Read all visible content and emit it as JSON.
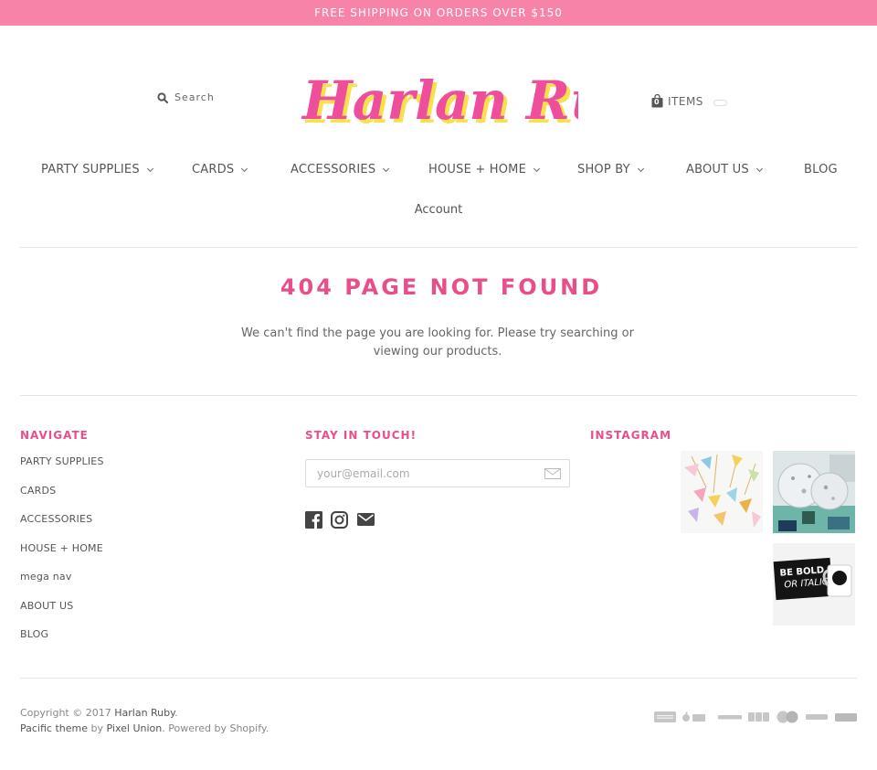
{
  "promo": {
    "text": "FREE SHIPPING ON ORDERS OVER $150"
  },
  "header": {
    "search_label": "Search",
    "logo_text": "Harlan Ruby",
    "cart_count": "0",
    "cart_label": "ITEMS"
  },
  "nav": {
    "items": [
      {
        "label": "PARTY SUPPLIES",
        "has_dropdown": true
      },
      {
        "label": "CARDS",
        "has_dropdown": true
      },
      {
        "label": "ACCESSORIES",
        "has_dropdown": true
      },
      {
        "label": "HOUSE + HOME",
        "has_dropdown": true
      },
      {
        "label": "SHOP BY",
        "has_dropdown": true
      },
      {
        "label": "ABOUT US",
        "has_dropdown": true
      },
      {
        "label": "BLOG",
        "has_dropdown": false
      }
    ],
    "account_label": "Account"
  },
  "error": {
    "title": "404 PAGE NOT FOUND",
    "message_before": "We can't find the page you are looking for. Please try ",
    "search_link": "searching",
    "message_middle": " or viewing our ",
    "products_link": "products",
    "message_after": "."
  },
  "footer": {
    "navigate_heading": "NAVIGATE",
    "navigate_links": [
      "PARTY SUPPLIES",
      "CARDS",
      "ACCESSORIES",
      "HOUSE + HOME",
      "mega nav",
      "ABOUT US",
      "BLOG"
    ],
    "touch_heading": "STAY IN TOUCH!",
    "email_placeholder": "your@email.com",
    "social_icons": [
      "facebook-icon",
      "instagram-icon",
      "mail-icon"
    ],
    "instagram_heading": "INSTAGRAM",
    "instagram_photos": [
      "paper-party-picks",
      "confetti-balloon",
      "be-bold-mug"
    ],
    "copyright_prefix": "Copyright © 2017 ",
    "store_name": "Harlan Ruby",
    "copyright_suffix": ".",
    "theme_name": "Pacific theme",
    "by_text": " by ",
    "theme_author": "Pixel Union",
    "powered_text": ". Powered by Shopify.",
    "payment_methods": [
      "american-express",
      "apple-pay",
      "discover",
      "jcb",
      "master",
      "paypal",
      "visa"
    ]
  },
  "colors": {
    "promo_bar": "#f783a9",
    "accent_pink": "#e84f8a",
    "logo_pink": "#ee4e9b",
    "logo_yellow": "#f8e14a"
  }
}
